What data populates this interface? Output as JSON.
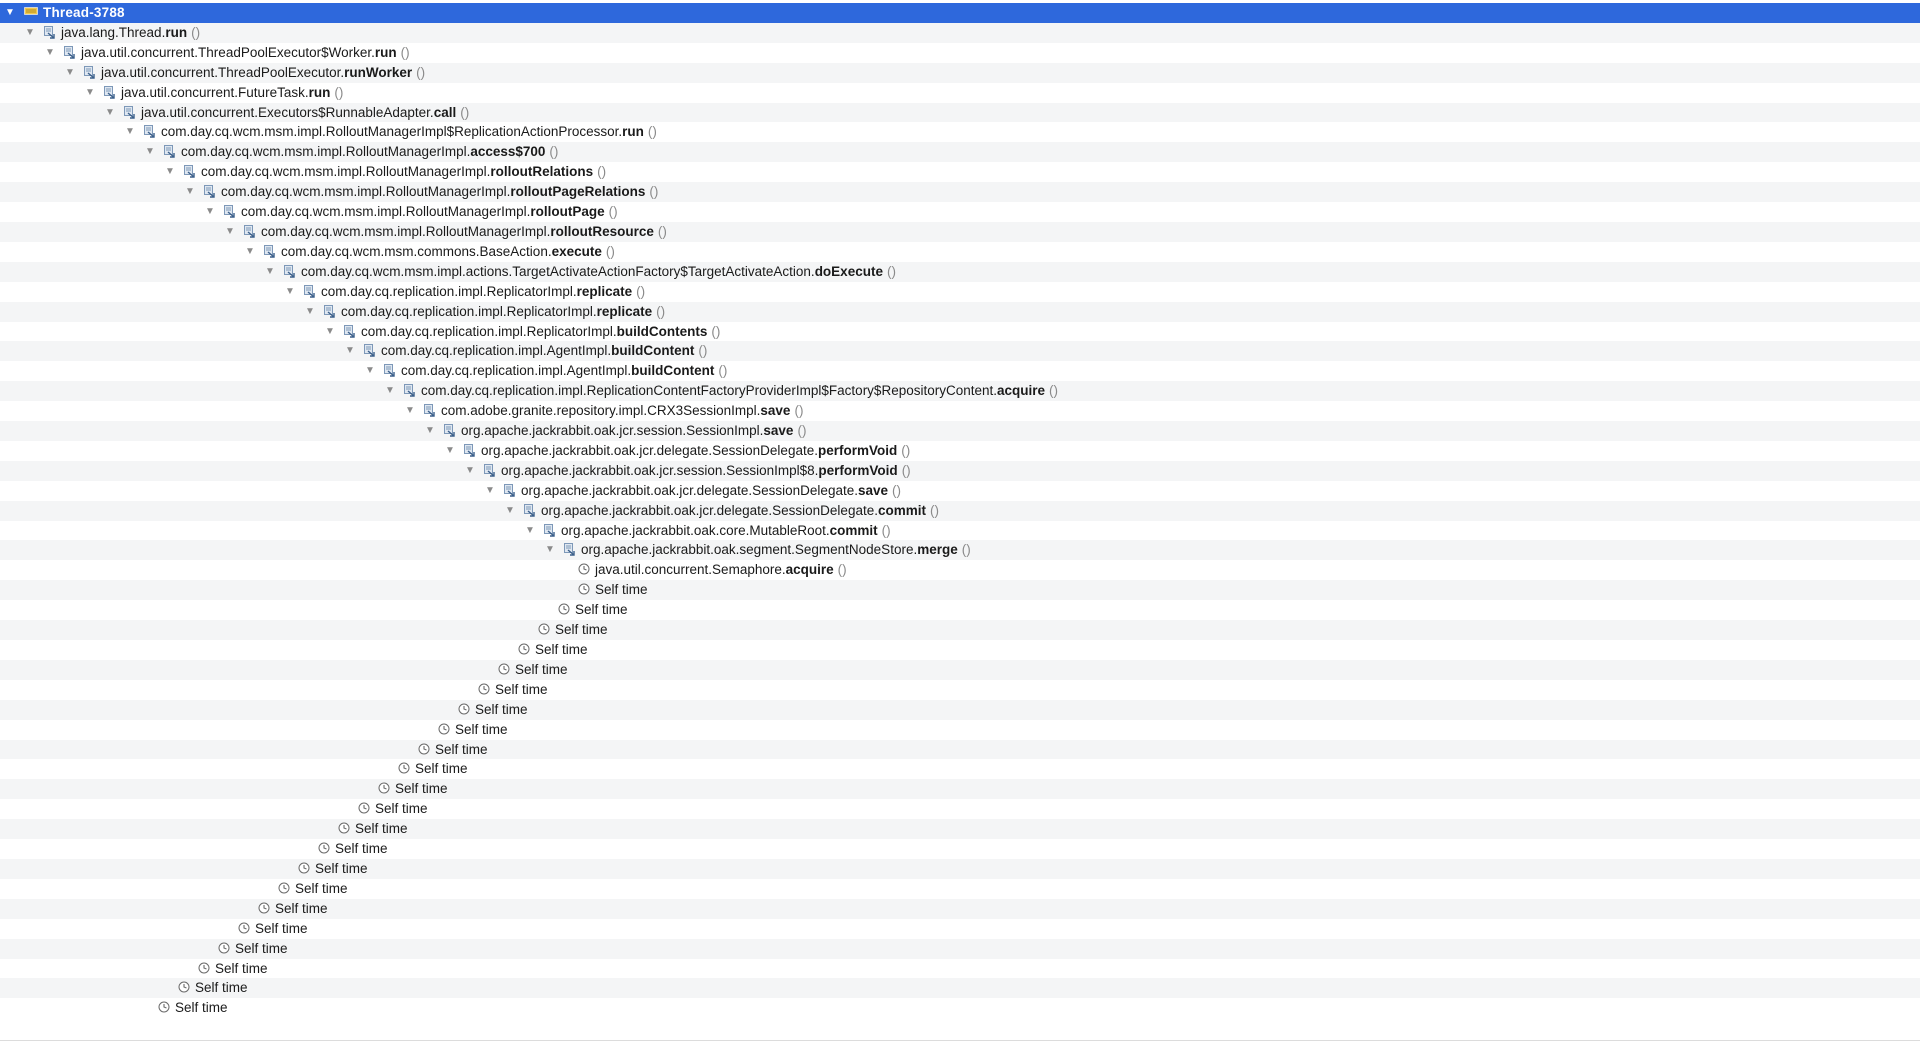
{
  "window": {
    "root_label": "Thread-3788",
    "colors": {
      "selection": "#2e68dc",
      "alt_row": "#f4f5f6",
      "call_icon": "#6e8fb3",
      "clock_icon": "#707070"
    }
  },
  "tree": {
    "frames": [
      {
        "pkg": "java.lang.Thread.",
        "method": "run"
      },
      {
        "pkg": "java.util.concurrent.ThreadPoolExecutor$Worker.",
        "method": "run"
      },
      {
        "pkg": "java.util.concurrent.ThreadPoolExecutor.",
        "method": "runWorker"
      },
      {
        "pkg": "java.util.concurrent.FutureTask.",
        "method": "run"
      },
      {
        "pkg": "java.util.concurrent.Executors$RunnableAdapter.",
        "method": "call"
      },
      {
        "pkg": "com.day.cq.wcm.msm.impl.RolloutManagerImpl$ReplicationActionProcessor.",
        "method": "run"
      },
      {
        "pkg": "com.day.cq.wcm.msm.impl.RolloutManagerImpl.",
        "method": "access$700"
      },
      {
        "pkg": "com.day.cq.wcm.msm.impl.RolloutManagerImpl.",
        "method": "rolloutRelations"
      },
      {
        "pkg": "com.day.cq.wcm.msm.impl.RolloutManagerImpl.",
        "method": "rolloutPageRelations"
      },
      {
        "pkg": "com.day.cq.wcm.msm.impl.RolloutManagerImpl.",
        "method": "rolloutPage"
      },
      {
        "pkg": "com.day.cq.wcm.msm.impl.RolloutManagerImpl.",
        "method": "rolloutResource"
      },
      {
        "pkg": "com.day.cq.wcm.msm.commons.BaseAction.",
        "method": "execute"
      },
      {
        "pkg": "com.day.cq.wcm.msm.impl.actions.TargetActivateActionFactory$TargetActivateAction.",
        "method": "doExecute"
      },
      {
        "pkg": "com.day.cq.replication.impl.ReplicatorImpl.",
        "method": "replicate"
      },
      {
        "pkg": "com.day.cq.replication.impl.ReplicatorImpl.",
        "method": "replicate"
      },
      {
        "pkg": "com.day.cq.replication.impl.ReplicatorImpl.",
        "method": "buildContents"
      },
      {
        "pkg": "com.day.cq.replication.impl.AgentImpl.",
        "method": "buildContent"
      },
      {
        "pkg": "com.day.cq.replication.impl.AgentImpl.",
        "method": "buildContent"
      },
      {
        "pkg": "com.day.cq.replication.impl.ReplicationContentFactoryProviderImpl$Factory$RepositoryContent.",
        "method": "acquire"
      },
      {
        "pkg": "com.adobe.granite.repository.impl.CRX3SessionImpl.",
        "method": "save"
      },
      {
        "pkg": "org.apache.jackrabbit.oak.jcr.session.SessionImpl.",
        "method": "save"
      },
      {
        "pkg": "org.apache.jackrabbit.oak.jcr.delegate.SessionDelegate.",
        "method": "performVoid"
      },
      {
        "pkg": "org.apache.jackrabbit.oak.jcr.session.SessionImpl$8.",
        "method": "performVoid"
      },
      {
        "pkg": "org.apache.jackrabbit.oak.jcr.delegate.SessionDelegate.",
        "method": "save"
      },
      {
        "pkg": "org.apache.jackrabbit.oak.jcr.delegate.SessionDelegate.",
        "method": "commit"
      },
      {
        "pkg": "org.apache.jackrabbit.oak.core.MutableRoot.",
        "method": "commit"
      },
      {
        "pkg": "org.apache.jackrabbit.oak.segment.SegmentNodeStore.",
        "method": "merge"
      }
    ],
    "leaf_call": {
      "pkg": "java.util.concurrent.Semaphore.",
      "method": "acquire"
    },
    "parens": "()",
    "self_time_label": "Self time"
  }
}
